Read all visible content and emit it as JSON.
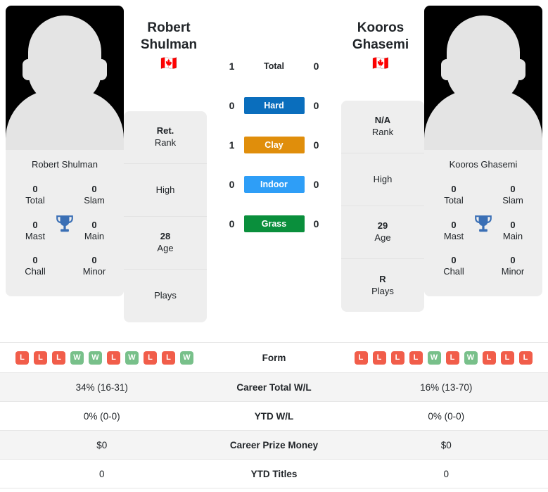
{
  "players": {
    "left": {
      "first_name": "Robert",
      "last_name": "Shulman",
      "full_name": "Robert Shulman",
      "flag": "🇨🇦",
      "avatar_icon": "player-silhouette-icon",
      "titles": [
        {
          "value": "0",
          "label": "Total"
        },
        {
          "value": "0",
          "label": "Slam"
        },
        {
          "value": "0",
          "label": "Mast"
        },
        {
          "value": "0",
          "label": "Main"
        },
        {
          "value": "0",
          "label": "Chall"
        },
        {
          "value": "0",
          "label": "Minor"
        }
      ],
      "info": [
        {
          "value": "Ret.",
          "label": "Rank"
        },
        {
          "value": "",
          "label": "High"
        },
        {
          "value": "28",
          "label": "Age"
        },
        {
          "value": "",
          "label": "Plays"
        }
      ],
      "form": [
        "L",
        "L",
        "L",
        "W",
        "W",
        "L",
        "W",
        "L",
        "L",
        "W"
      ]
    },
    "right": {
      "first_name": "Kooros",
      "last_name": "Ghasemi",
      "full_name": "Kooros Ghasemi",
      "flag": "🇨🇦",
      "avatar_icon": "player-silhouette-icon",
      "titles": [
        {
          "value": "0",
          "label": "Total"
        },
        {
          "value": "0",
          "label": "Slam"
        },
        {
          "value": "0",
          "label": "Mast"
        },
        {
          "value": "0",
          "label": "Main"
        },
        {
          "value": "0",
          "label": "Chall"
        },
        {
          "value": "0",
          "label": "Minor"
        }
      ],
      "info": [
        {
          "value": "N/A",
          "label": "Rank"
        },
        {
          "value": "",
          "label": "High"
        },
        {
          "value": "29",
          "label": "Age"
        },
        {
          "value": "R",
          "label": "Plays"
        }
      ],
      "form": [
        "L",
        "L",
        "L",
        "L",
        "W",
        "L",
        "W",
        "L",
        "L",
        "L"
      ]
    }
  },
  "head_to_head": [
    {
      "label": "Total",
      "left": "1",
      "right": "0",
      "color": "",
      "plain": true
    },
    {
      "label": "Hard",
      "left": "0",
      "right": "0",
      "color": "#0a6ebd",
      "plain": false
    },
    {
      "label": "Clay",
      "left": "1",
      "right": "0",
      "color": "#e08e0b",
      "plain": false
    },
    {
      "label": "Indoor",
      "left": "0",
      "right": "0",
      "color": "#2e9ef7",
      "plain": false
    },
    {
      "label": "Grass",
      "left": "0",
      "right": "0",
      "color": "#0a8f3c",
      "plain": false
    }
  ],
  "stats_table": {
    "rows": [
      {
        "label": "Form",
        "left": "",
        "right": "",
        "type": "form"
      },
      {
        "label": "Career Total W/L",
        "left": "34% (16-31)",
        "right": "16% (13-70)",
        "type": "text"
      },
      {
        "label": "YTD W/L",
        "left": "0% (0-0)",
        "right": "0% (0-0)",
        "type": "text"
      },
      {
        "label": "Career Prize Money",
        "left": "$0",
        "right": "$0",
        "type": "text"
      },
      {
        "label": "YTD Titles",
        "left": "0",
        "right": "0",
        "type": "text"
      }
    ]
  },
  "colors": {
    "win": "#78c08a",
    "loss": "#f15d4a",
    "trophy": "#3a6fb5",
    "card_bg": "#eeeeee",
    "row_alt": "#f4f4f4"
  }
}
